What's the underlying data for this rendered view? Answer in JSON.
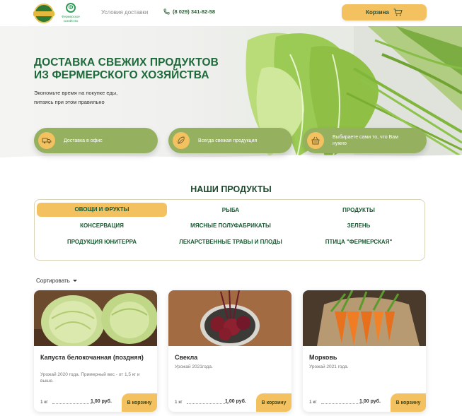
{
  "header": {
    "logo_alt": "ФЕРМЕРСКОЕ",
    "logo2_line1": "Фермерское",
    "logo2_line2": "хозяйство",
    "nav_delivery": "Условия доставки",
    "phone": "(8 029) 341-82-58",
    "cart_label": "Корзина"
  },
  "hero": {
    "title": "ДОСТАВКА СВЕЖИХ ПРОДУКТОВ\nИЗ ФЕРМЕРСКОГО ХОЗЯЙСТВА",
    "subtitle": "Экономьте время на покупке еды,\nпитаясь при этом правильно",
    "features": [
      {
        "label": "Доставка в офис",
        "icon": "truck-icon"
      },
      {
        "label": "Всегда свежая продукция",
        "icon": "leaf-icon"
      },
      {
        "label": "Выбираете сами то, что Вам нужно",
        "icon": "basket-icon"
      }
    ]
  },
  "products": {
    "title": "НАШИ ПРОДУКТЫ",
    "categories": [
      "ОВОЩИ И ФРУКТЫ",
      "РЫБА",
      "ПРОДУКТЫ",
      "КОНСЕРВАЦИЯ",
      "МЯСНЫЕ ПОЛУФАБРИКАТЫ",
      "ЗЕЛЕНЬ",
      "ПРОДУКЦИЯ ЮНИТЕРРА",
      "ЛЕКАРСТВЕННЫЕ ТРАВЫ И ПЛОДЫ",
      "ПТИЦА \"ФЕРМЕРСКАЯ\""
    ],
    "active_category": "ОВОЩИ И ФРУКТЫ",
    "sort_label": "Сортировать"
  },
  "cards": [
    {
      "name": "Капуста белокочанная (поздняя)",
      "desc": "Урожай 2020 года. Примерный вес - от 1,5 кг и выше.",
      "unit": "1 кг",
      "price": "1.00 руб.",
      "button": "В корзину",
      "image": "cabbage-image"
    },
    {
      "name": "Свекла",
      "desc": "Урожай 2021года.",
      "unit": "1 кг",
      "price": "1.00 руб.",
      "button": "В корзину",
      "image": "beet-image"
    },
    {
      "name": "Морковь",
      "desc": "Урожай 2021 года.",
      "unit": "1 кг",
      "price": "1.00 руб.",
      "button": "В корзину",
      "image": "carrot-image"
    }
  ],
  "colors": {
    "accent": "#f4c160",
    "green_dark": "#1d6a3a",
    "feature_green": "#95b05f"
  }
}
